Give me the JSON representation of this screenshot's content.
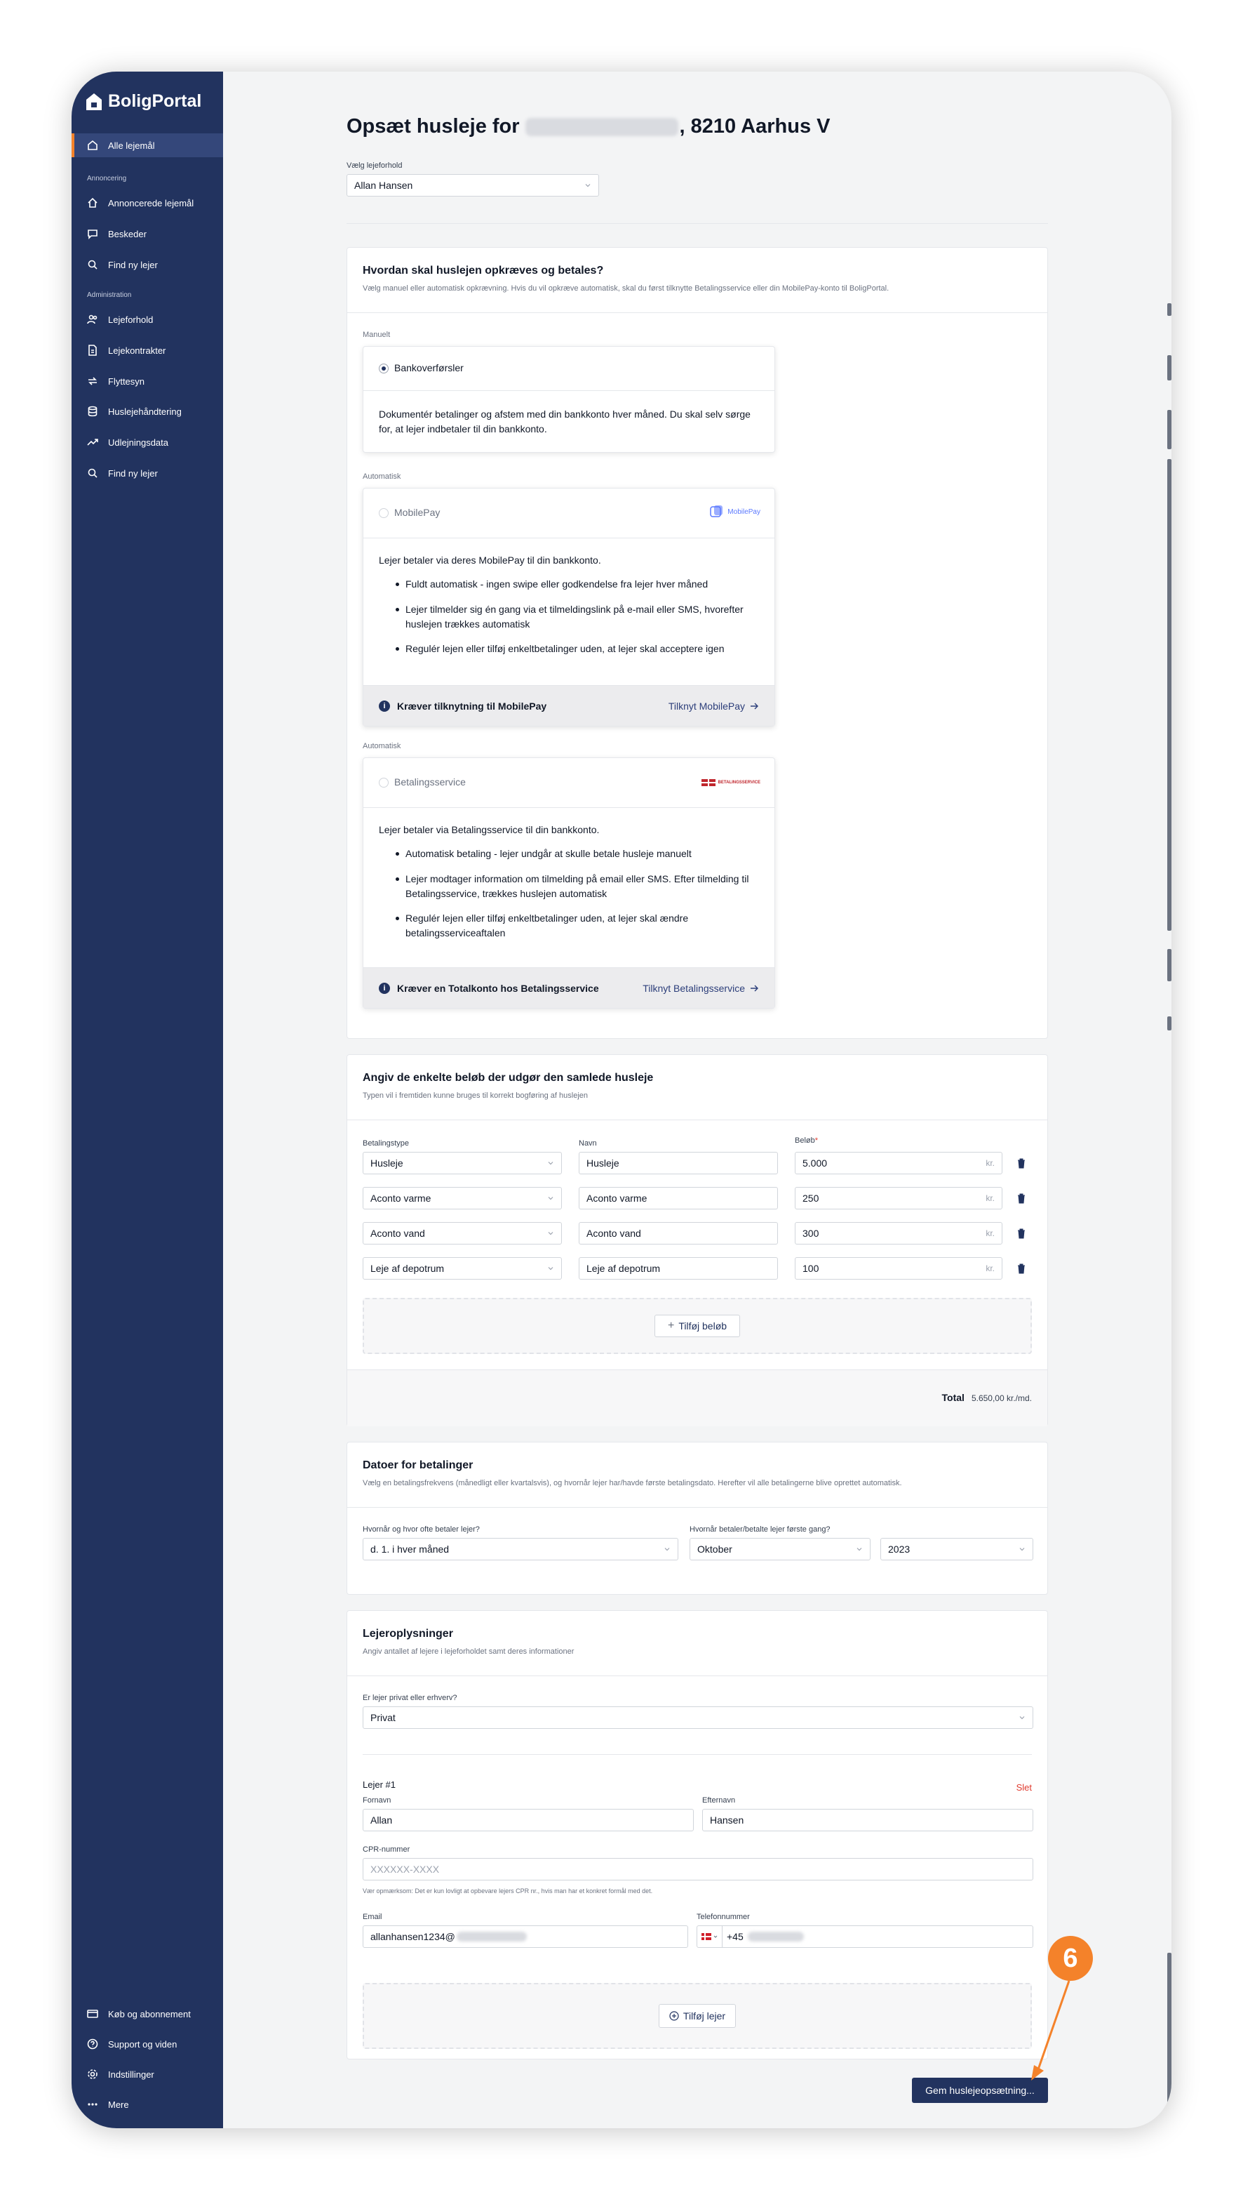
{
  "app": {
    "logo_text": "BoligPortal"
  },
  "sidebar": {
    "active_item": "Alle lejemål",
    "sections": {
      "annoncering": "Annoncering",
      "administration": "Administration"
    },
    "annoncering_items": [
      "Annoncerede lejemål",
      "Beskeder",
      "Find ny lejer"
    ],
    "administration_items": [
      "Lejeforhold",
      "Lejekontrakter",
      "Flyttesyn",
      "Huslejehåndtering",
      "Udlejningsdata",
      "Find ny lejer"
    ],
    "bottom_items": [
      "Køb og abonnement",
      "Support og viden",
      "Indstillinger",
      "Mere"
    ]
  },
  "header": {
    "title_prefix": "Opsæt husleje for",
    "title_suffix": ", 8210 Aarhus V"
  },
  "tenant_select": {
    "label": "Vælg lejeforhold",
    "value": "Allan Hansen"
  },
  "payment_method": {
    "title": "Hvordan skal huslejen opkræves og betales?",
    "subtitle": "Vælg manuel eller automatisk opkrævning. Hvis du vil opkræve automatisk, skal du først tilknytte Betalingsservice eller din MobilePay-konto til BoligPortal.",
    "manual": {
      "group_label": "Manuelt",
      "name": "Bankoverførsler",
      "description": "Dokumentér betalinger og afstem med din bankkonto hver måned. Du skal selv sørge for, at lejer indbetaler til din bankkonto."
    },
    "mobilepay": {
      "group_label": "Automatisk",
      "name": "MobilePay",
      "logo_text": "MobilePay",
      "intro": "Lejer betaler via deres MobilePay til din bankkonto.",
      "bullets": [
        "Fuldt automatisk - ingen swipe eller godkendelse fra lejer hver måned",
        "Lejer tilmelder sig én gang via et tilmeldingslink på e-mail eller SMS, hvorefter huslejen trækkes automatisk",
        "Regulér lejen eller tilføj enkeltbetalinger uden, at lejer skal acceptere igen"
      ],
      "footer_note": "Kræver tilknytning til MobilePay",
      "footer_link": "Tilknyt MobilePay"
    },
    "betalingsservice": {
      "group_label": "Automatisk",
      "name": "Betalingsservice",
      "logo_text": "BETALINGSSERVICE",
      "intro": "Lejer betaler via Betalingsservice til din bankkonto.",
      "bullets": [
        "Automatisk betaling - lejer undgår at skulle betale husleje manuelt",
        "Lejer modtager information om tilmelding på email eller SMS. Efter tilmelding til Betalingsservice, trækkes huslejen automatisk",
        "Regulér lejen eller tilføj enkeltbetalinger uden, at lejer skal ændre betalingsserviceaftalen"
      ],
      "footer_note": "Kræver en Totalkonto hos Betalingsservice",
      "footer_link": "Tilknyt Betalingsservice"
    }
  },
  "amounts": {
    "title": "Angiv de enkelte beløb der udgør den samlede husleje",
    "subtitle": "Typen vil i fremtiden kunne bruges til korrekt bogføring af huslejen",
    "col_type": "Betalingstype",
    "col_name": "Navn",
    "col_amount": "Beløb",
    "required_mark": "*",
    "currency": "kr.",
    "rows": [
      {
        "type": "Husleje",
        "name": "Husleje",
        "amount": "5.000"
      },
      {
        "type": "Aconto varme",
        "name": "Aconto varme",
        "amount": "250"
      },
      {
        "type": "Aconto vand",
        "name": "Aconto vand",
        "amount": "300"
      },
      {
        "type": "Leje af depotrum",
        "name": "Leje af depotrum",
        "amount": "100"
      }
    ],
    "add_button": "Tilføj beløb",
    "total_label": "Total",
    "total_value": "5.650,00 kr./md."
  },
  "dates": {
    "title": "Datoer for betalinger",
    "subtitle": "Vælg en betalingsfrekvens (månedligt eller kvartalsvis), og hvornår lejer har/havde første betalingsdato. Herefter vil alle betalingerne blive oprettet automatisk.",
    "frequency_label": "Hvornår og hvor ofte betaler lejer?",
    "frequency_value": "d. 1. i hver måned",
    "first_label": "Hvornår betaler/betalte lejer første gang?",
    "month_value": "Oktober",
    "year_value": "2023"
  },
  "tenants": {
    "title": "Lejeroplysninger",
    "subtitle": "Angiv antallet af lejere i lejeforholdet samt deres informationer",
    "type_label": "Er lejer privat eller erhverv?",
    "type_value": "Privat",
    "tenant_heading": "Lejer #1",
    "delete_link": "Slet",
    "firstname_label": "Fornavn",
    "firstname_value": "Allan",
    "lastname_label": "Efternavn",
    "lastname_value": "Hansen",
    "cpr_label": "CPR-nummer",
    "cpr_placeholder": "XXXXXX-XXXX",
    "cpr_note": "Vær opmærksom: Det er kun lovligt at opbevare lejers CPR nr., hvis man har et konkret formål med det.",
    "email_label": "Email",
    "email_value": "allanhansen1234@",
    "phone_label": "Telefonnummer",
    "phone_prefix": "+45",
    "add_tenant_button": "Tilføj lejer"
  },
  "save_button": "Gem huslejeopsætning...",
  "annotation": {
    "step_number": "6",
    "color": "#f4822a"
  },
  "colors": {
    "sidebar": "#22335f",
    "accent": "#f4822a",
    "primary": "#22335f",
    "delete": "#e03b2f"
  }
}
